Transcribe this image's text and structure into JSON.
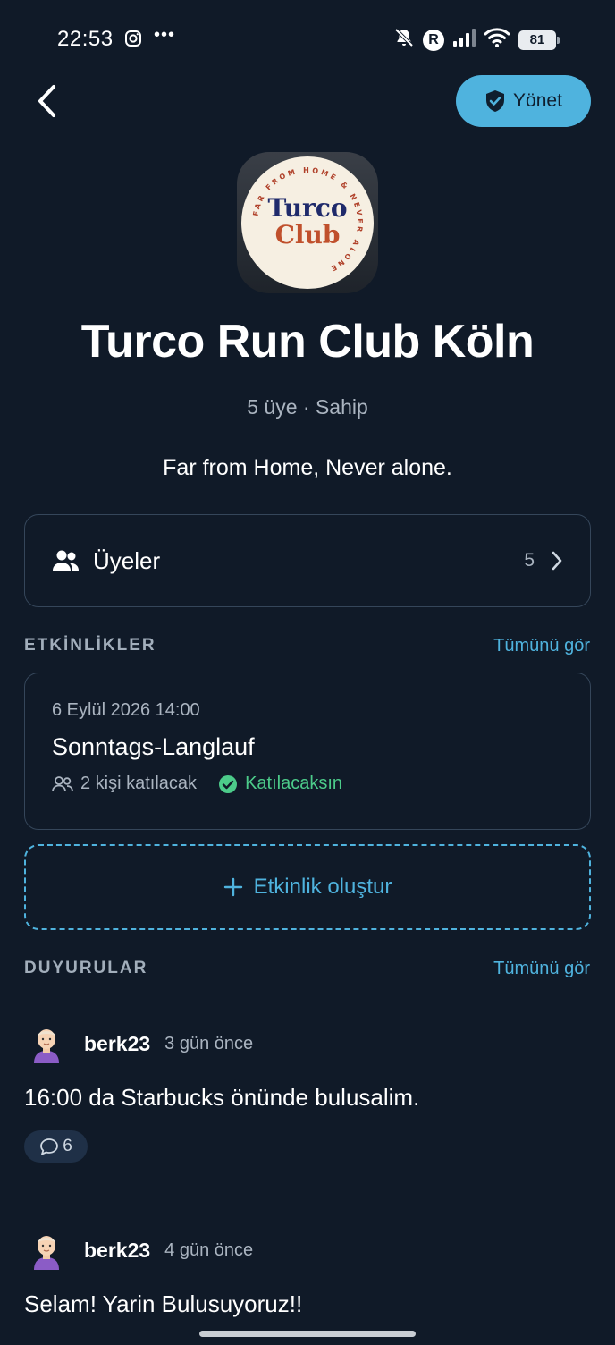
{
  "status_bar": {
    "time": "22:53",
    "battery": "81",
    "carrier_badge": "R"
  },
  "header": {
    "manage_label": "Yönet"
  },
  "club": {
    "logo_text_top": "Turco",
    "logo_text_bottom": "Club",
    "logo_ring_text": "FAR FROM HOME & NEVER ALONE",
    "name": "Turco Run Club Köln",
    "meta": "5 üye · Sahip",
    "description": "Far from Home, Never alone."
  },
  "members": {
    "label": "Üyeler",
    "count": "5"
  },
  "events_section": {
    "title": "ETKİNLİKLER",
    "see_all": "Tümünü gör",
    "items": [
      {
        "date": "6 Eylül 2026 14:00",
        "name": "Sonntags-Langlauf",
        "attendees": "2 kişi katılacak",
        "status": "Katılacaksın"
      }
    ],
    "create_label": "Etkinlik oluştur"
  },
  "announcements_section": {
    "title": "DUYURULAR",
    "see_all": "Tümünü gör",
    "posts": [
      {
        "author": "berk23",
        "time": "3 gün önce",
        "text": "16:00 da Starbucks önünde bulusalim.",
        "comments": "6"
      },
      {
        "author": "berk23",
        "time": "4 gün önce",
        "text": "Selam! Yarin Bulusuyoruz!!"
      }
    ]
  },
  "colors": {
    "background": "#101a28",
    "accent": "#4fb3de",
    "success": "#4ccb8a",
    "card_border": "#35465a",
    "muted_text": "#aab4c0"
  }
}
